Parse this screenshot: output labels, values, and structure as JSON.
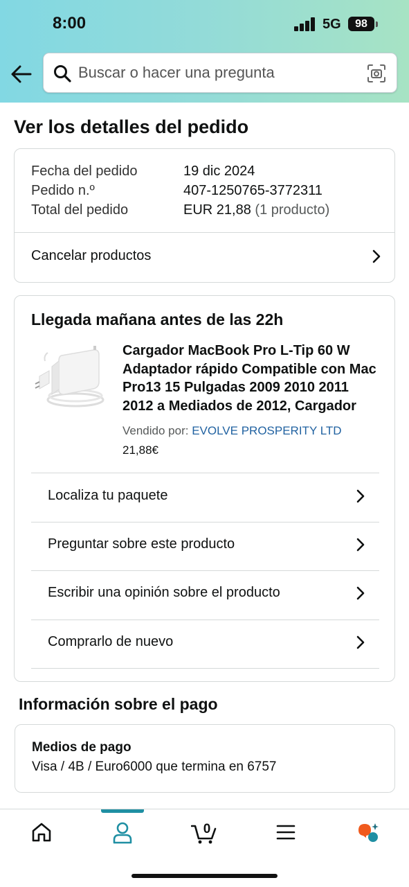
{
  "status_bar": {
    "time": "8:00",
    "network": "5G",
    "battery": "98"
  },
  "search": {
    "placeholder": "Buscar o hacer una pregunta"
  },
  "page": {
    "title": "Ver los detalles del pedido"
  },
  "order_summary": {
    "date_label": "Fecha del pedido",
    "date_value": "19 dic 2024",
    "number_label": "Pedido n.º",
    "number_value": "407-1250765-3772311",
    "total_label": "Total del pedido",
    "total_value": "EUR 21,88",
    "total_count": "(1 producto)",
    "cancel_label": "Cancelar productos"
  },
  "shipment": {
    "heading": "Llegada mañana antes de las 22h",
    "product_title": "Cargador MacBook Pro L-Tip 60 W Adaptador rápido Compatible con Mac Pro13 15 Pulgadas 2009 2010 2011 2012 a Mediados de 2012, Cargador",
    "sold_by_label": "Vendido por:",
    "seller": "EVOLVE PROSPERITY LTD",
    "price": "21,88€",
    "actions": [
      {
        "label": "Localiza tu paquete"
      },
      {
        "label": "Preguntar sobre este producto"
      },
      {
        "label": "Escribir una opinión sobre el producto"
      },
      {
        "label": "Comprarlo de nuevo"
      }
    ]
  },
  "payment": {
    "heading": "Información sobre el pago",
    "methods_label": "Medios de pago",
    "method_value": "Visa / 4B / Euro6000  que termina en 6757"
  },
  "bottom_nav": {
    "items": [
      {
        "icon": "home-icon"
      },
      {
        "icon": "account-icon",
        "active": true
      },
      {
        "icon": "cart-icon",
        "count": "0"
      },
      {
        "icon": "menu-icon"
      },
      {
        "icon": "rufus-icon"
      }
    ],
    "accent": "#1f8fa3"
  },
  "colors": {
    "link": "#2162a1",
    "header_start": "#82d8e3",
    "header_end": "#a7e3c4"
  }
}
